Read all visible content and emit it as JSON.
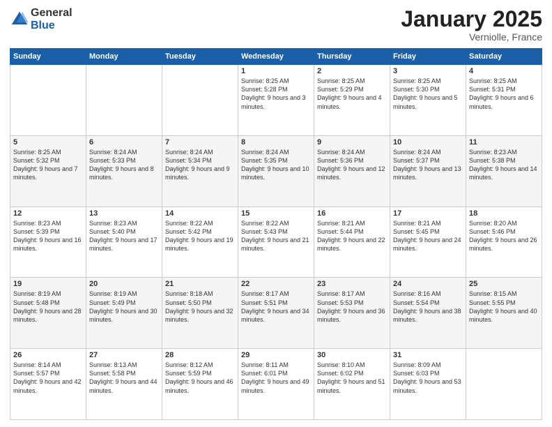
{
  "header": {
    "logo_general": "General",
    "logo_blue": "Blue",
    "month_title": "January 2025",
    "location": "Verniolle, France"
  },
  "days_of_week": [
    "Sunday",
    "Monday",
    "Tuesday",
    "Wednesday",
    "Thursday",
    "Friday",
    "Saturday"
  ],
  "weeks": [
    [
      {
        "num": "",
        "text": ""
      },
      {
        "num": "",
        "text": ""
      },
      {
        "num": "",
        "text": ""
      },
      {
        "num": "1",
        "text": "Sunrise: 8:25 AM\nSunset: 5:28 PM\nDaylight: 9 hours and 3 minutes."
      },
      {
        "num": "2",
        "text": "Sunrise: 8:25 AM\nSunset: 5:29 PM\nDaylight: 9 hours and 4 minutes."
      },
      {
        "num": "3",
        "text": "Sunrise: 8:25 AM\nSunset: 5:30 PM\nDaylight: 9 hours and 5 minutes."
      },
      {
        "num": "4",
        "text": "Sunrise: 8:25 AM\nSunset: 5:31 PM\nDaylight: 9 hours and 6 minutes."
      }
    ],
    [
      {
        "num": "5",
        "text": "Sunrise: 8:25 AM\nSunset: 5:32 PM\nDaylight: 9 hours and 7 minutes."
      },
      {
        "num": "6",
        "text": "Sunrise: 8:24 AM\nSunset: 5:33 PM\nDaylight: 9 hours and 8 minutes."
      },
      {
        "num": "7",
        "text": "Sunrise: 8:24 AM\nSunset: 5:34 PM\nDaylight: 9 hours and 9 minutes."
      },
      {
        "num": "8",
        "text": "Sunrise: 8:24 AM\nSunset: 5:35 PM\nDaylight: 9 hours and 10 minutes."
      },
      {
        "num": "9",
        "text": "Sunrise: 8:24 AM\nSunset: 5:36 PM\nDaylight: 9 hours and 12 minutes."
      },
      {
        "num": "10",
        "text": "Sunrise: 8:24 AM\nSunset: 5:37 PM\nDaylight: 9 hours and 13 minutes."
      },
      {
        "num": "11",
        "text": "Sunrise: 8:23 AM\nSunset: 5:38 PM\nDaylight: 9 hours and 14 minutes."
      }
    ],
    [
      {
        "num": "12",
        "text": "Sunrise: 8:23 AM\nSunset: 5:39 PM\nDaylight: 9 hours and 16 minutes."
      },
      {
        "num": "13",
        "text": "Sunrise: 8:23 AM\nSunset: 5:40 PM\nDaylight: 9 hours and 17 minutes."
      },
      {
        "num": "14",
        "text": "Sunrise: 8:22 AM\nSunset: 5:42 PM\nDaylight: 9 hours and 19 minutes."
      },
      {
        "num": "15",
        "text": "Sunrise: 8:22 AM\nSunset: 5:43 PM\nDaylight: 9 hours and 21 minutes."
      },
      {
        "num": "16",
        "text": "Sunrise: 8:21 AM\nSunset: 5:44 PM\nDaylight: 9 hours and 22 minutes."
      },
      {
        "num": "17",
        "text": "Sunrise: 8:21 AM\nSunset: 5:45 PM\nDaylight: 9 hours and 24 minutes."
      },
      {
        "num": "18",
        "text": "Sunrise: 8:20 AM\nSunset: 5:46 PM\nDaylight: 9 hours and 26 minutes."
      }
    ],
    [
      {
        "num": "19",
        "text": "Sunrise: 8:19 AM\nSunset: 5:48 PM\nDaylight: 9 hours and 28 minutes."
      },
      {
        "num": "20",
        "text": "Sunrise: 8:19 AM\nSunset: 5:49 PM\nDaylight: 9 hours and 30 minutes."
      },
      {
        "num": "21",
        "text": "Sunrise: 8:18 AM\nSunset: 5:50 PM\nDaylight: 9 hours and 32 minutes."
      },
      {
        "num": "22",
        "text": "Sunrise: 8:17 AM\nSunset: 5:51 PM\nDaylight: 9 hours and 34 minutes."
      },
      {
        "num": "23",
        "text": "Sunrise: 8:17 AM\nSunset: 5:53 PM\nDaylight: 9 hours and 36 minutes."
      },
      {
        "num": "24",
        "text": "Sunrise: 8:16 AM\nSunset: 5:54 PM\nDaylight: 9 hours and 38 minutes."
      },
      {
        "num": "25",
        "text": "Sunrise: 8:15 AM\nSunset: 5:55 PM\nDaylight: 9 hours and 40 minutes."
      }
    ],
    [
      {
        "num": "26",
        "text": "Sunrise: 8:14 AM\nSunset: 5:57 PM\nDaylight: 9 hours and 42 minutes."
      },
      {
        "num": "27",
        "text": "Sunrise: 8:13 AM\nSunset: 5:58 PM\nDaylight: 9 hours and 44 minutes."
      },
      {
        "num": "28",
        "text": "Sunrise: 8:12 AM\nSunset: 5:59 PM\nDaylight: 9 hours and 46 minutes."
      },
      {
        "num": "29",
        "text": "Sunrise: 8:11 AM\nSunset: 6:01 PM\nDaylight: 9 hours and 49 minutes."
      },
      {
        "num": "30",
        "text": "Sunrise: 8:10 AM\nSunset: 6:02 PM\nDaylight: 9 hours and 51 minutes."
      },
      {
        "num": "31",
        "text": "Sunrise: 8:09 AM\nSunset: 6:03 PM\nDaylight: 9 hours and 53 minutes."
      },
      {
        "num": "",
        "text": ""
      }
    ]
  ]
}
